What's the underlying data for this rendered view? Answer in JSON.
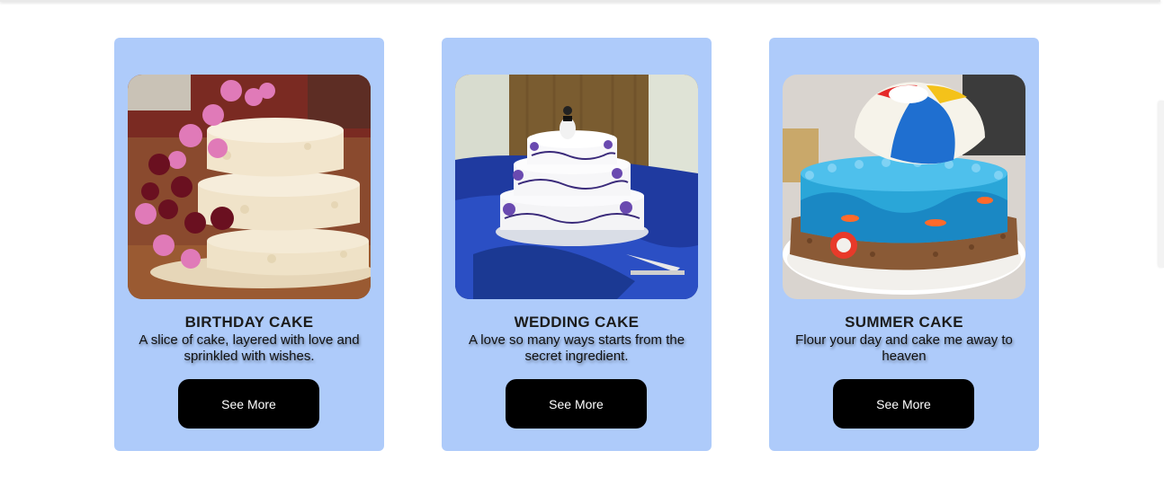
{
  "cards": [
    {
      "title": "BIRTHDAY CAKE",
      "description": "A slice of cake, layered with love and sprinkled with wishes.",
      "button_label": "See More",
      "image_icon": "birthday-cake-photo"
    },
    {
      "title": "WEDDING CAKE",
      "description": "A love so many ways starts from the secret ingredient.",
      "button_label": "See More",
      "image_icon": "wedding-cake-photo"
    },
    {
      "title": "SUMMER CAKE",
      "description": "Flour your day and cake me away to heaven",
      "button_label": "See More",
      "image_icon": "summer-cake-photo"
    }
  ],
  "colors": {
    "card_background": "#aecbfa",
    "button_background": "#000000",
    "button_text": "#ffffff",
    "title_text": "#1c1c1c"
  }
}
